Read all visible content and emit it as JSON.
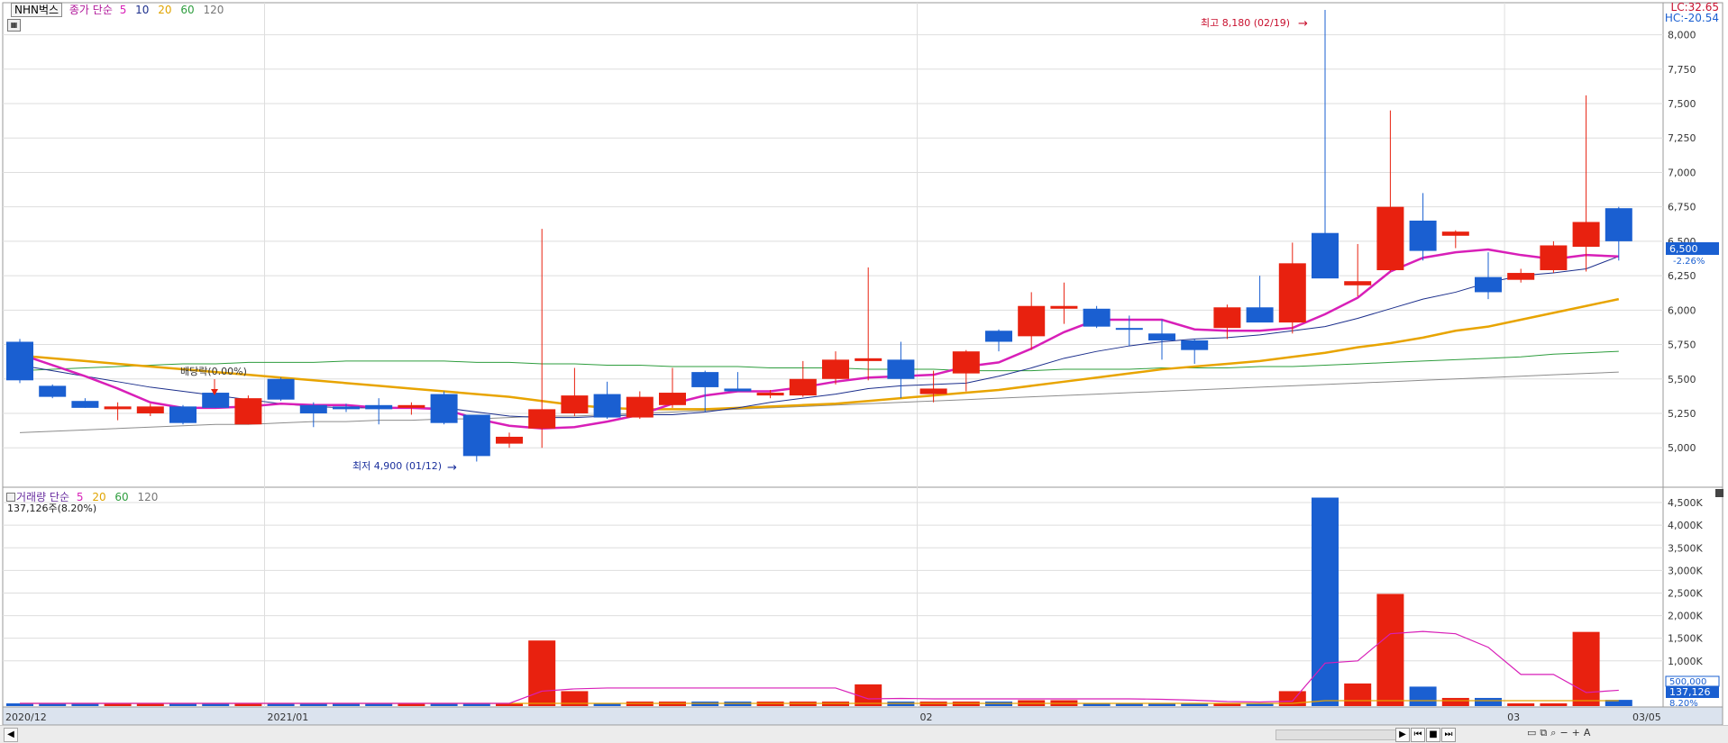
{
  "legend": {
    "stock_name": "NHN벅스",
    "price_title": "종가 단순",
    "ma5": "5",
    "ma10": "10",
    "ma20": "20",
    "ma60": "60",
    "ma120": "120",
    "volume_title": "거래량 단순"
  },
  "info": {
    "lc": "LC:32.65",
    "hc": "HC:-20.54",
    "current_price": "6,500",
    "change_pct": "-2.26%",
    "volume_summary": "137,126주(8.20%)",
    "current_volume": "137,126",
    "volume_ma": "500,000",
    "volume_pct": "8.20%"
  },
  "annotations": {
    "high": "최고 8,180 (02/19)",
    "low": "최저 4,900 (01/12)",
    "dividend": "배당락(0.00%)"
  },
  "date_labels": [
    "2020/12",
    "2021/01",
    "02",
    "03",
    "03/05"
  ],
  "price_axis_labels": [
    "8,000",
    "7,750",
    "7,500",
    "7,250",
    "7,000",
    "6,750",
    "6,500",
    "6,250",
    "6,000",
    "5,750",
    "5,500",
    "5,250",
    "5,000"
  ],
  "volume_axis_labels": [
    "4,500K",
    "4,000K",
    "3,500K",
    "3,000K",
    "2,500K",
    "2,000K",
    "1,500K",
    "1,000K"
  ],
  "colors": {
    "up": "#e8210f",
    "down": "#1a5fd1",
    "ma5": "#d81fb8",
    "ma10": "#1c2f8c",
    "ma20": "#e8a400",
    "ma60": "#2e9d3e",
    "ma120": "#8c8c8c",
    "grid": "#dedede",
    "axis_text": "#333333"
  },
  "icons": [
    "chart-settings-icon",
    "scroll-left-icon",
    "first-icon",
    "prev-icon",
    "stop-icon",
    "next-icon",
    "zoom-icon",
    "zoom-out-icon",
    "zoom-in-icon",
    "auto-icon"
  ],
  "chart_data": {
    "type": "candlestick",
    "price_range": [
      4720,
      8200
    ],
    "volume_range_k": [
      0,
      4700
    ],
    "candles": [
      {
        "o": 5490,
        "h": 5790,
        "l": 5470,
        "c": 5770,
        "v": 60,
        "d": 1
      },
      {
        "o": 5450,
        "h": 5460,
        "l": 5360,
        "c": 5370,
        "v": 60,
        "d": 1
      },
      {
        "o": 5340,
        "h": 5360,
        "l": 5290,
        "c": 5290,
        "v": 60,
        "d": 1
      },
      {
        "o": 5280,
        "h": 5330,
        "l": 5200,
        "c": 5300,
        "v": 60,
        "d": 0
      },
      {
        "o": 5250,
        "h": 5320,
        "l": 5230,
        "c": 5300,
        "v": 60,
        "d": 0
      },
      {
        "o": 5300,
        "h": 5310,
        "l": 5170,
        "c": 5180,
        "v": 60,
        "d": 1
      },
      {
        "o": 5400,
        "h": 5410,
        "l": 5290,
        "c": 5290,
        "v": 60,
        "d": 1
      },
      {
        "o": 5170,
        "h": 5380,
        "l": 5170,
        "c": 5360,
        "v": 60,
        "d": 0
      },
      {
        "o": 5500,
        "h": 5510,
        "l": 5340,
        "c": 5350,
        "v": 60,
        "d": 1
      },
      {
        "o": 5310,
        "h": 5330,
        "l": 5150,
        "c": 5250,
        "v": 60,
        "d": 1
      },
      {
        "o": 5300,
        "h": 5320,
        "l": 5260,
        "c": 5280,
        "v": 60,
        "d": 1
      },
      {
        "o": 5310,
        "h": 5360,
        "l": 5170,
        "c": 5280,
        "v": 60,
        "d": 1
      },
      {
        "o": 5290,
        "h": 5330,
        "l": 5240,
        "c": 5310,
        "v": 60,
        "d": 0
      },
      {
        "o": 5390,
        "h": 5410,
        "l": 5170,
        "c": 5180,
        "v": 60,
        "d": 1
      },
      {
        "o": 5240,
        "h": 5240,
        "l": 4900,
        "c": 4940,
        "v": 60,
        "d": 1
      },
      {
        "o": 5030,
        "h": 5110,
        "l": 5000,
        "c": 5080,
        "v": 60,
        "d": 0
      },
      {
        "o": 5140,
        "h": 6590,
        "l": 5000,
        "c": 5280,
        "v": 1450,
        "d": 0
      },
      {
        "o": 5250,
        "h": 5580,
        "l": 5230,
        "c": 5380,
        "v": 330,
        "d": 0
      },
      {
        "o": 5390,
        "h": 5480,
        "l": 5210,
        "c": 5220,
        "v": 50,
        "d": 1
      },
      {
        "o": 5220,
        "h": 5410,
        "l": 5210,
        "c": 5370,
        "v": 100,
        "d": 0
      },
      {
        "o": 5310,
        "h": 5580,
        "l": 5290,
        "c": 5400,
        "v": 100,
        "d": 0
      },
      {
        "o": 5550,
        "h": 5560,
        "l": 5260,
        "c": 5440,
        "v": 100,
        "d": 1
      },
      {
        "o": 5430,
        "h": 5550,
        "l": 5420,
        "c": 5410,
        "v": 100,
        "d": 1
      },
      {
        "o": 5380,
        "h": 5420,
        "l": 5360,
        "c": 5400,
        "v": 100,
        "d": 0
      },
      {
        "o": 5380,
        "h": 5630,
        "l": 5370,
        "c": 5500,
        "v": 100,
        "d": 0
      },
      {
        "o": 5500,
        "h": 5700,
        "l": 5460,
        "c": 5640,
        "v": 100,
        "d": 0
      },
      {
        "o": 5630,
        "h": 6310,
        "l": 5490,
        "c": 5650,
        "v": 480,
        "d": 0
      },
      {
        "o": 5640,
        "h": 5770,
        "l": 5360,
        "c": 5500,
        "v": 100,
        "d": 1
      },
      {
        "o": 5390,
        "h": 5560,
        "l": 5330,
        "c": 5430,
        "v": 100,
        "d": 0
      },
      {
        "o": 5540,
        "h": 5710,
        "l": 5410,
        "c": 5700,
        "v": 100,
        "d": 0
      },
      {
        "o": 5850,
        "h": 5860,
        "l": 5700,
        "c": 5770,
        "v": 100,
        "d": 1
      },
      {
        "o": 5810,
        "h": 6130,
        "l": 5710,
        "c": 6030,
        "v": 130,
        "d": 0
      },
      {
        "o": 6030,
        "h": 6200,
        "l": 5900,
        "c": 6010,
        "v": 130,
        "d": 0
      },
      {
        "o": 6010,
        "h": 6030,
        "l": 5870,
        "c": 5880,
        "v": 60,
        "d": 1
      },
      {
        "o": 5870,
        "h": 5960,
        "l": 5740,
        "c": 5860,
        "v": 60,
        "d": 1
      },
      {
        "o": 5830,
        "h": 5930,
        "l": 5640,
        "c": 5780,
        "v": 60,
        "d": 1
      },
      {
        "o": 5780,
        "h": 5790,
        "l": 5610,
        "c": 5710,
        "v": 60,
        "d": 1
      },
      {
        "o": 5870,
        "h": 6040,
        "l": 5790,
        "c": 6020,
        "v": 60,
        "d": 0
      },
      {
        "o": 6020,
        "h": 6250,
        "l": 5920,
        "c": 5910,
        "v": 60,
        "d": 1
      },
      {
        "o": 5910,
        "h": 6490,
        "l": 5830,
        "c": 6340,
        "v": 330,
        "d": 0
      },
      {
        "o": 6560,
        "h": 8180,
        "l": 6240,
        "c": 6230,
        "v": 4610,
        "d": 1
      },
      {
        "o": 6210,
        "h": 6480,
        "l": 6100,
        "c": 6180,
        "v": 500,
        "d": 0
      },
      {
        "o": 6290,
        "h": 7450,
        "l": 6280,
        "c": 6750,
        "v": 2480,
        "d": 0
      },
      {
        "o": 6650,
        "h": 6850,
        "l": 6360,
        "c": 6430,
        "v": 430,
        "d": 1
      },
      {
        "o": 6540,
        "h": 6580,
        "l": 6450,
        "c": 6570,
        "v": 180,
        "d": 0
      },
      {
        "o": 6240,
        "h": 6420,
        "l": 6080,
        "c": 6130,
        "v": 180,
        "d": 1
      },
      {
        "o": 6220,
        "h": 6300,
        "l": 6200,
        "c": 6270,
        "v": 60,
        "d": 0
      },
      {
        "o": 6290,
        "h": 6500,
        "l": 6270,
        "c": 6470,
        "v": 60,
        "d": 0
      },
      {
        "o": 6460,
        "h": 7560,
        "l": 6280,
        "c": 6640,
        "v": 1640,
        "d": 0
      },
      {
        "o": 6740,
        "h": 6750,
        "l": 6360,
        "c": 6500,
        "v": 137,
        "d": 1
      }
    ],
    "ma5": [
      5680,
      5600,
      5520,
      5430,
      5330,
      5290,
      5290,
      5300,
      5320,
      5310,
      5310,
      5290,
      5290,
      5280,
      5210,
      5160,
      5140,
      5150,
      5190,
      5240,
      5320,
      5380,
      5410,
      5410,
      5440,
      5480,
      5510,
      5520,
      5530,
      5590,
      5620,
      5720,
      5840,
      5930,
      5930,
      5930,
      5860,
      5850,
      5850,
      5870,
      5970,
      6090,
      6280,
      6380,
      6420,
      6440,
      6400,
      6370,
      6400,
      6390
    ],
    "ma10": [
      5600,
      5560,
      5520,
      5480,
      5440,
      5410,
      5380,
      5350,
      5320,
      5300,
      5290,
      5290,
      5290,
      5290,
      5260,
      5230,
      5220,
      5220,
      5230,
      5240,
      5240,
      5260,
      5290,
      5330,
      5360,
      5390,
      5430,
      5450,
      5460,
      5470,
      5520,
      5580,
      5650,
      5700,
      5740,
      5770,
      5790,
      5800,
      5820,
      5850,
      5880,
      5940,
      6010,
      6080,
      6130,
      6200,
      6250,
      6270,
      6300,
      6390
    ],
    "ma20": [
      5670,
      5650,
      5630,
      5610,
      5590,
      5570,
      5550,
      5530,
      5510,
      5490,
      5470,
      5450,
      5430,
      5410,
      5390,
      5370,
      5340,
      5310,
      5290,
      5280,
      5280,
      5280,
      5290,
      5300,
      5310,
      5320,
      5340,
      5360,
      5380,
      5400,
      5420,
      5450,
      5480,
      5510,
      5540,
      5570,
      5590,
      5610,
      5630,
      5660,
      5690,
      5730,
      5760,
      5800,
      5850,
      5880,
      5930,
      5980,
      6030,
      6080
    ],
    "ma60": [
      5560,
      5570,
      5580,
      5590,
      5600,
      5610,
      5610,
      5620,
      5620,
      5620,
      5630,
      5630,
      5630,
      5630,
      5620,
      5620,
      5610,
      5610,
      5600,
      5600,
      5590,
      5590,
      5590,
      5580,
      5580,
      5580,
      5570,
      5570,
      5570,
      5560,
      5560,
      5560,
      5570,
      5570,
      5570,
      5580,
      5580,
      5580,
      5590,
      5590,
      5600,
      5610,
      5620,
      5630,
      5640,
      5650,
      5660,
      5680,
      5690,
      5700
    ],
    "ma120": [
      5110,
      5120,
      5130,
      5140,
      5150,
      5160,
      5170,
      5170,
      5180,
      5190,
      5190,
      5200,
      5200,
      5210,
      5210,
      5220,
      5230,
      5230,
      5240,
      5250,
      5260,
      5270,
      5280,
      5290,
      5300,
      5310,
      5320,
      5330,
      5340,
      5350,
      5360,
      5370,
      5380,
      5390,
      5400,
      5410,
      5420,
      5430,
      5440,
      5450,
      5460,
      5470,
      5480,
      5490,
      5500,
      5510,
      5520,
      5530,
      5540,
      5550
    ],
    "vol_ma5": [
      60,
      60,
      60,
      60,
      60,
      60,
      60,
      60,
      60,
      60,
      60,
      60,
      60,
      60,
      60,
      60,
      330,
      380,
      400,
      400,
      400,
      400,
      400,
      400,
      400,
      400,
      160,
      170,
      160,
      160,
      160,
      160,
      160,
      160,
      160,
      150,
      130,
      100,
      90,
      110,
      950,
      1000,
      1600,
      1650,
      1600,
      1300,
      700,
      700,
      300,
      350
    ],
    "vol_ma20": [
      60,
      60,
      60,
      60,
      60,
      60,
      60,
      60,
      60,
      60,
      60,
      60,
      60,
      60,
      60,
      60,
      60,
      60,
      60,
      60,
      60,
      60,
      60,
      60,
      60,
      60,
      60,
      60,
      60,
      60,
      60,
      60,
      60,
      60,
      60,
      60,
      60,
      60,
      60,
      60,
      120,
      120,
      120,
      120,
      120,
      120,
      120,
      120,
      120,
      120
    ]
  }
}
